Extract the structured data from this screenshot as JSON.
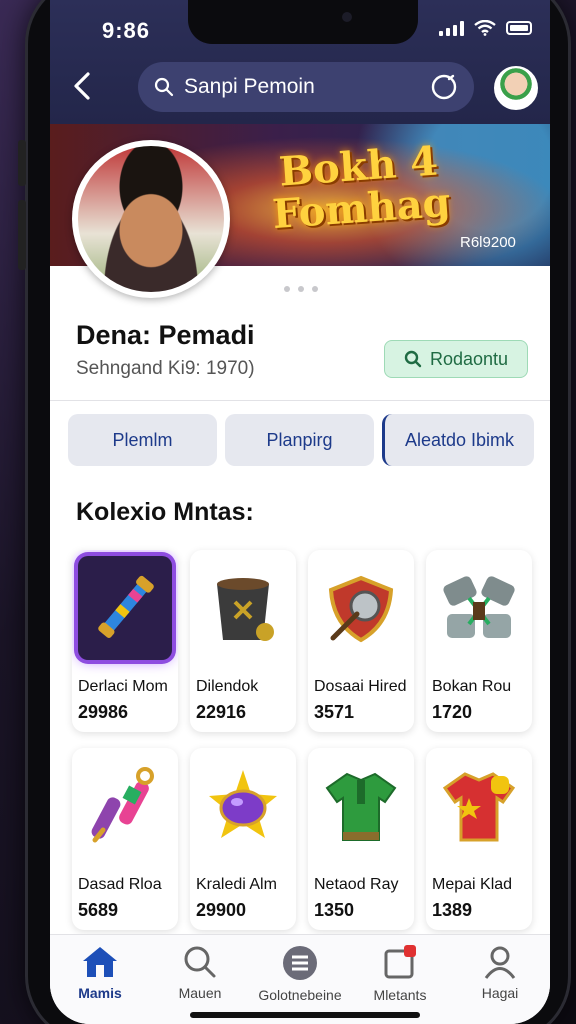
{
  "status_bar": {
    "time": "9:86"
  },
  "header": {
    "search_text": "Sanpi Pemoin"
  },
  "banner": {
    "title_line1": "Bokh 4",
    "title_line2": "Fomhag",
    "subtitle": "R6l9200"
  },
  "profile": {
    "name": "Dena: Pemadi",
    "subtitle": "Sehngand Ki9: 1970)",
    "follow_label": "Rodaontu"
  },
  "tabs": [
    {
      "label": "Plemlm"
    },
    {
      "label": "Planpirg"
    },
    {
      "label": "Aleatdo Ibimk"
    }
  ],
  "collection": {
    "title": "Kolexio Mntas:",
    "items": [
      {
        "name": "Derlaci Mom",
        "count": "29986",
        "icon": "torch-icon",
        "color": "#d7a12a"
      },
      {
        "name": "Dilendok",
        "count": "22916",
        "icon": "bucket-icon",
        "color": "#444"
      },
      {
        "name": "Dosaai Hired",
        "count": "3571",
        "icon": "shield-axe-icon",
        "color": "#c0392b"
      },
      {
        "name": "Bokan Rou",
        "count": "1720",
        "icon": "hammer-icon",
        "color": "#666"
      },
      {
        "name": "Dasad Rloa",
        "count": "5689",
        "icon": "scroll-icon",
        "color": "#8e44ad"
      },
      {
        "name": "Kraledi Alm",
        "count": "29900",
        "icon": "gem-star-icon",
        "color": "#7d3cc8"
      },
      {
        "name": "Netaod Ray",
        "count": "1350",
        "icon": "green-shirt-icon",
        "color": "#2e9b3e"
      },
      {
        "name": "Mepai Klad",
        "count": "1389",
        "icon": "red-jersey-icon",
        "color": "#d63031"
      }
    ]
  },
  "bottom_nav": [
    {
      "label": "Mamis",
      "icon": "home-icon",
      "active": true
    },
    {
      "label": "Mauen",
      "icon": "search-icon",
      "active": false
    },
    {
      "label": "Golotnebeine",
      "icon": "list-icon",
      "active": false
    },
    {
      "label": "Mletants",
      "icon": "notification-icon",
      "active": false
    },
    {
      "label": "Hagai",
      "icon": "profile-icon",
      "active": false
    }
  ],
  "colors": {
    "header_bg": "#2c2f58",
    "accent": "#1d3a8a",
    "follow_bg": "#d7f3e2"
  }
}
